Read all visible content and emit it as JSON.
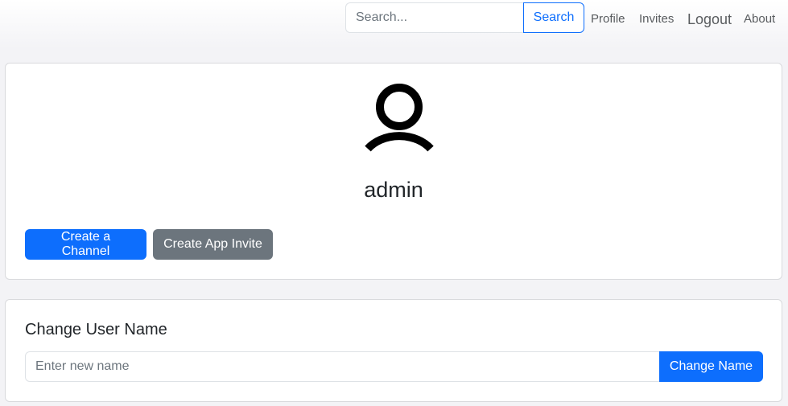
{
  "navbar": {
    "search": {
      "placeholder": "Search...",
      "value": "",
      "button_label": "Search"
    },
    "links": {
      "profile": "Profile",
      "invites": "Invites",
      "logout": "Logout",
      "about": "About"
    }
  },
  "profile": {
    "avatar_icon": "user-icon",
    "username": "admin",
    "create_channel_label": "Create a Channel",
    "create_invite_label": "Create App Invite"
  },
  "change_name": {
    "title": "Change User Name",
    "input_placeholder": "Enter new name",
    "input_value": "",
    "button_label": "Change Name"
  },
  "colors": {
    "primary": "#0d6efd",
    "secondary": "#6c757d",
    "page_background": "#f3f3f6"
  }
}
